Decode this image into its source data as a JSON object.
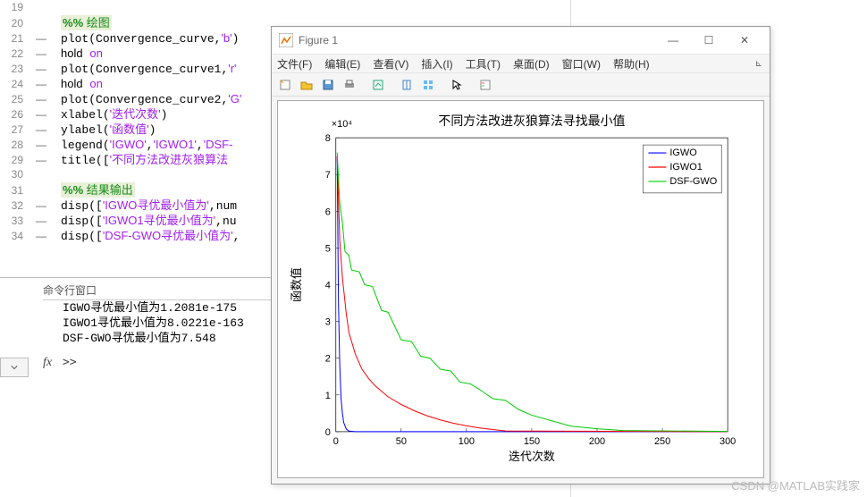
{
  "editor": {
    "lines": [
      {
        "n": 19,
        "bp": "",
        "raw": ""
      },
      {
        "n": 20,
        "bp": "",
        "raw": "<span class='section-header'><span class='sec'>%%</span> <span class='sec-comment'>绘图</span></span>"
      },
      {
        "n": 21,
        "bp": "—",
        "raw": "plot(Convergence_curve,<span class='str'>'b'</span>)"
      },
      {
        "n": 22,
        "bp": "—",
        "raw": "<span class='kw-hold'>hold</span> <span class='str'>on</span>"
      },
      {
        "n": 23,
        "bp": "—",
        "raw": "plot(Convergence_curve1,<span class='str'>'r'</span>"
      },
      {
        "n": 24,
        "bp": "—",
        "raw": "<span class='kw-hold'>hold</span> <span class='str'>on</span>"
      },
      {
        "n": 25,
        "bp": "—",
        "raw": "plot(Convergence_curve2,<span class='str'>'G'</span>"
      },
      {
        "n": 26,
        "bp": "—",
        "raw": "xlabel(<span class='str'>'迭代次数'</span>)"
      },
      {
        "n": 27,
        "bp": "—",
        "raw": "ylabel(<span class='str'>'函数值'</span>)"
      },
      {
        "n": 28,
        "bp": "—",
        "raw": "legend(<span class='str'>'IGWO'</span>,<span class='str'>'IGWO1'</span>,<span class='str'>'DSF-</span>"
      },
      {
        "n": 29,
        "bp": "—",
        "raw": "title([<span class='str'>'不同方法改进灰狼算法</span>"
      },
      {
        "n": 30,
        "bp": "",
        "raw": ""
      },
      {
        "n": 31,
        "bp": "",
        "raw": "<span class='section-header'><span class='sec'>%%</span> <span class='sec-comment'>结果输出</span></span>"
      },
      {
        "n": 32,
        "bp": "—",
        "raw": "disp([<span class='str'>'IGWO寻优最小值为'</span>,num"
      },
      {
        "n": 33,
        "bp": "—",
        "raw": "disp([<span class='str'>'IGWO1寻优最小值为'</span>,nu"
      },
      {
        "n": 34,
        "bp": "—",
        "raw": "disp([<span class='str'>'DSF-GWO寻优最小值为'</span>,"
      }
    ]
  },
  "cmd": {
    "title": "命令行窗口",
    "lines": [
      "IGWO寻优最小值为1.2081e-175",
      "IGWO1寻优最小值为8.0221e-163",
      "DSF-GWO寻优最小值为7.548"
    ],
    "prompt": ">>"
  },
  "figure": {
    "title": "Figure 1",
    "menu": [
      "文件(F)",
      "编辑(E)",
      "查看(V)",
      "插入(I)",
      "工具(T)",
      "桌面(D)",
      "窗口(W)",
      "帮助(H)"
    ]
  },
  "chart_data": {
    "type": "line",
    "title": "不同方法改进灰狼算法寻找最小值",
    "xlabel": "迭代次数",
    "ylabel": "函数值",
    "xlim": [
      0,
      300
    ],
    "ylim": [
      0,
      80000
    ],
    "y_scale_label": "×10⁴",
    "xticks": [
      0,
      50,
      100,
      150,
      200,
      250,
      300
    ],
    "yticks": [
      0,
      1,
      2,
      3,
      4,
      5,
      6,
      7,
      8
    ],
    "series": [
      {
        "name": "IGWO",
        "color": "#0000ff",
        "x": [
          1,
          2,
          3,
          4,
          5,
          6,
          8,
          10,
          15,
          20,
          300
        ],
        "y": [
          75000,
          35000,
          18000,
          9000,
          5000,
          2500,
          700,
          150,
          10,
          0,
          0
        ]
      },
      {
        "name": "IGWO1",
        "color": "#ff0000",
        "x": [
          1,
          3,
          5,
          8,
          10,
          15,
          20,
          25,
          30,
          40,
          50,
          60,
          70,
          80,
          90,
          100,
          110,
          120,
          130,
          300
        ],
        "y": [
          75000,
          52000,
          42000,
          32000,
          27000,
          21000,
          17000,
          14500,
          12500,
          9500,
          7400,
          5700,
          4300,
          3200,
          2300,
          1600,
          1000,
          600,
          200,
          0
        ]
      },
      {
        "name": "DSF-GWO",
        "color": "#00cc00",
        "x": [
          1,
          3,
          5,
          7,
          10,
          12,
          18,
          22,
          28,
          35,
          40,
          50,
          58,
          65,
          72,
          80,
          88,
          95,
          103,
          110,
          120,
          130,
          140,
          150,
          165,
          180,
          200,
          220,
          300
        ],
        "y": [
          76000,
          62000,
          57000,
          49000,
          48000,
          44000,
          43500,
          40000,
          39500,
          33000,
          32500,
          25000,
          24500,
          20500,
          20000,
          17000,
          16500,
          13500,
          13000,
          11500,
          9000,
          8500,
          6000,
          4500,
          3000,
          1500,
          800,
          300,
          80
        ]
      }
    ]
  },
  "watermark": "CSDN @MATLAB实践家"
}
